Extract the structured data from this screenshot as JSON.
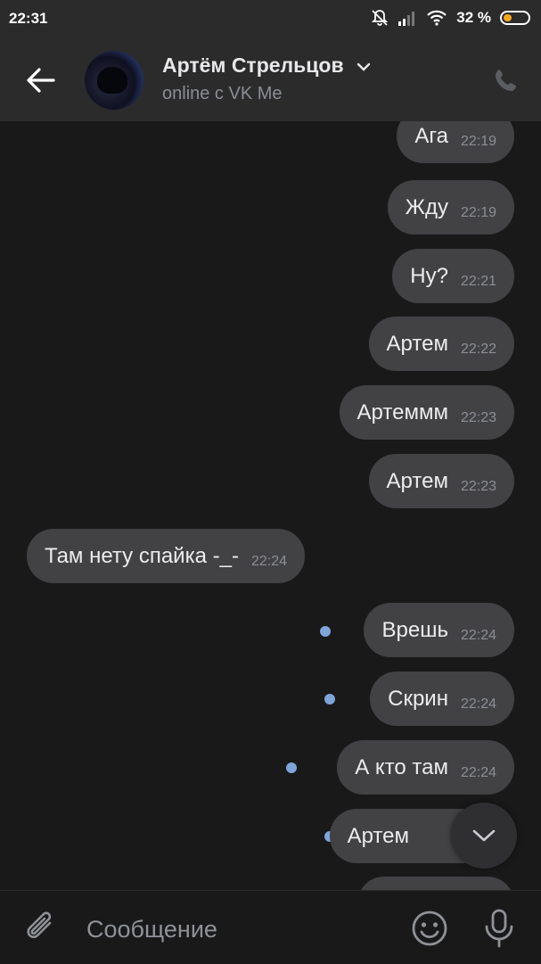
{
  "status_bar": {
    "time": "22:31",
    "battery": "32 %",
    "battery_level": 0.32
  },
  "header": {
    "contact_name": "Артём Стрельцов",
    "contact_status": "online с VK Me",
    "icons": {
      "back": "back-arrow-icon",
      "call": "phone-icon",
      "expand": "chevron-down-icon"
    }
  },
  "messages": [
    {
      "text": "Ага",
      "time": "22:19",
      "direction": "out",
      "unread": false
    },
    {
      "text": "Жду",
      "time": "22:19",
      "direction": "out",
      "unread": false
    },
    {
      "text": "Ну?",
      "time": "22:21",
      "direction": "out",
      "unread": false
    },
    {
      "text": "Артем",
      "time": "22:22",
      "direction": "out",
      "unread": false
    },
    {
      "text": "Артеммм",
      "time": "22:23",
      "direction": "out",
      "unread": false
    },
    {
      "text": "Артем",
      "time": "22:23",
      "direction": "out",
      "unread": false
    },
    {
      "text": "Там нету спайка -_-",
      "time": "22:24",
      "direction": "in",
      "unread": false
    },
    {
      "text": "Врешь",
      "time": "22:24",
      "direction": "out",
      "unread": true
    },
    {
      "text": "Скрин",
      "time": "22:24",
      "direction": "out",
      "unread": true
    },
    {
      "text": "А кто там",
      "time": "22:24",
      "direction": "out",
      "unread": true
    },
    {
      "text": "Артем",
      "time": "",
      "direction": "out",
      "unread": true
    }
  ],
  "composer": {
    "placeholder": "Сообщение"
  },
  "colors": {
    "background": "#19191a",
    "header": "#2b2b2c",
    "bubble": "#424244",
    "unread_dot": "#7fa4d8",
    "battery": "#f5a623"
  }
}
